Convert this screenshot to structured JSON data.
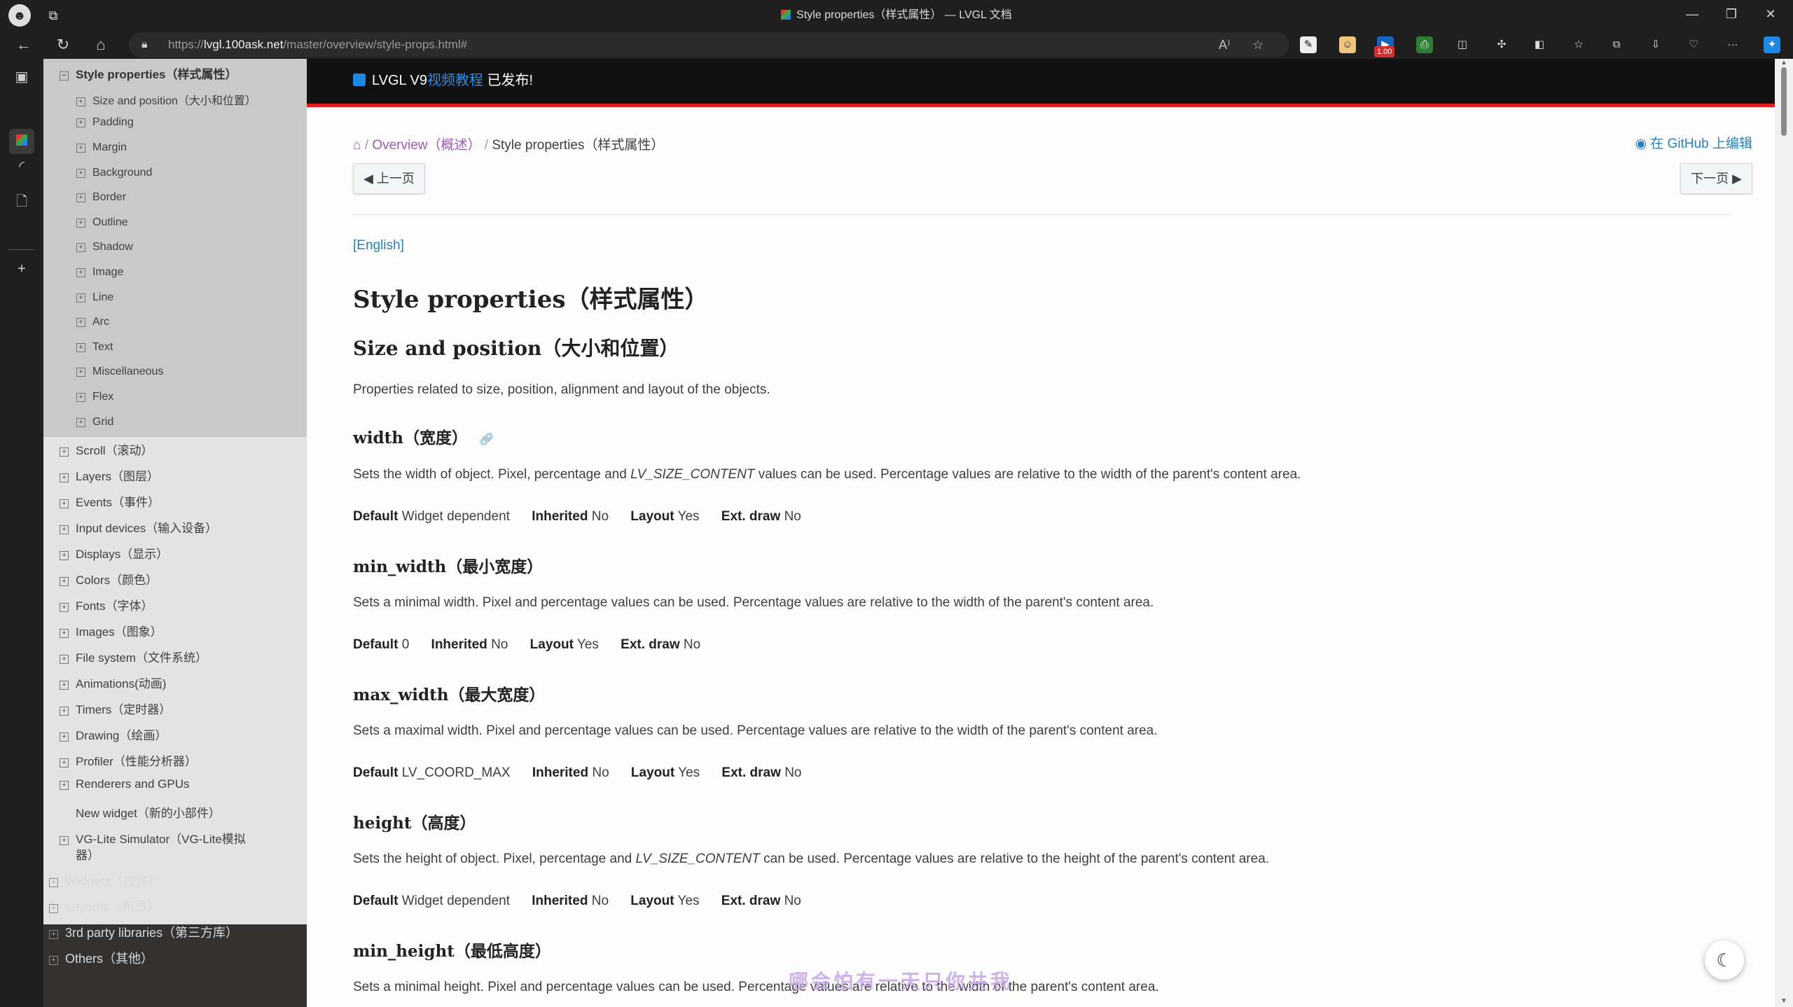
{
  "browser": {
    "window_title": "Style properties（样式属性） — LVGL 文档",
    "url_prefix": "https://",
    "url_host": "lvgl.100ask.net",
    "url_path": "/master/overview/style-props.html#",
    "badge": "1.00",
    "window_controls": {
      "minimize": "—",
      "restore": "❐",
      "close": "✕"
    },
    "more_label": "···"
  },
  "nav": {
    "current": "Style properties（样式属性）",
    "sub_items": [
      "Size and position（大小和位置）",
      "Padding",
      "Margin",
      "Background",
      "Border",
      "Outline",
      "Shadow",
      "Image",
      "Line",
      "Arc",
      "Text",
      "Miscellaneous",
      "Flex",
      "Grid"
    ],
    "siblings": [
      "Scroll（滚动）",
      "Layers（图层）",
      "Events（事件）",
      "Input devices（输入设备）",
      "Displays（显示）",
      "Colors（颜色）",
      "Fonts（字体）",
      "Images（图象）",
      "File system（文件系统）",
      "Animations(动画)",
      "Timers（定时器）",
      "Drawing（绘画）",
      "Profiler（性能分析器）",
      "Renderers and GPUs"
    ],
    "new_widget": "New widget（新的小部件）",
    "vg_lite_line1": "VG-Lite Simulator（VG-Lite模拟",
    "vg_lite_line2": "器）",
    "top_level": [
      "Widgets（控件）",
      "Layouts（布局）",
      "3rd party libraries（第三方库）",
      "Others（其他）"
    ]
  },
  "banner": {
    "prefix": "LVGL V9",
    "link": "视频教程",
    "suffix": " 已发布!"
  },
  "breadcrumb": {
    "home_icon": "home-icon",
    "parent": "Overview（概述）",
    "current": "Style properties（样式属性）",
    "separator": "/"
  },
  "github_link": "在 GitHub 上编辑",
  "pager": {
    "prev": "上一页",
    "next": "下一页"
  },
  "english_link": "[English]",
  "page_title": "Style properties（样式属性）",
  "section_title": "Size and position（大小和位置）",
  "section_intro": "Properties related to size, position, alignment and layout of the objects.",
  "labels": {
    "default": "Default",
    "inherited": "Inherited",
    "layout": "Layout",
    "ext_draw": "Ext. draw"
  },
  "props": {
    "width": {
      "title": "width（宽度）",
      "desc_a": "Sets the width of object. Pixel, percentage and ",
      "desc_italic": "LV_SIZE_CONTENT",
      "desc_b": " values can be used. Percentage values are relative to the width of the parent's content area.",
      "default": "Widget dependent",
      "inherited": "No",
      "layout": "Yes",
      "ext_draw": "No"
    },
    "min_width": {
      "title": "min_width（最小宽度）",
      "desc": "Sets a minimal width. Pixel and percentage values can be used. Percentage values are relative to the width of the parent's content area.",
      "default": "0",
      "inherited": "No",
      "layout": "Yes",
      "ext_draw": "No"
    },
    "max_width": {
      "title": "max_width（最大宽度）",
      "desc": "Sets a maximal width. Pixel and percentage values can be used. Percentage values are relative to the width of the parent's content area.",
      "default": "LV_COORD_MAX",
      "inherited": "No",
      "layout": "Yes",
      "ext_draw": "No"
    },
    "height": {
      "title": "height（高度）",
      "desc_a": "Sets the height of object. Pixel, percentage and ",
      "desc_italic": "LV_SIZE_CONTENT",
      "desc_b": " can be used. Percentage values are relative to the height of the parent's content area.",
      "default": "Widget dependent",
      "inherited": "No",
      "layout": "Yes",
      "ext_draw": "No"
    },
    "min_height": {
      "title": "min_height（最低高度）",
      "desc": "Sets a minimal height. Pixel and percentage values can be used. Percentage values are relative to the width of the parent's content area."
    }
  },
  "watermark": "哪会怕有一天只你共我",
  "colors": {
    "banner_accent": "#e31c1c",
    "link": "#2980b9",
    "breadcrumb_link": "#9b59b6",
    "nav_dark": "#343131"
  }
}
